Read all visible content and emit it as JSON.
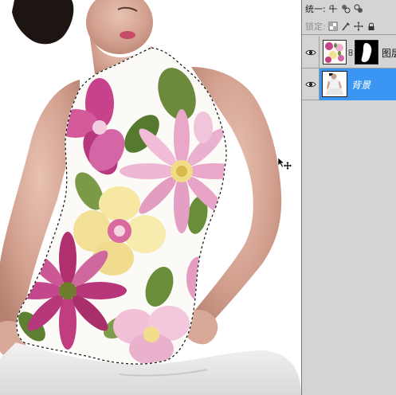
{
  "canvas": {
    "background": "#ffffff",
    "cursor_icon": "move-cursor-icon"
  },
  "layers_panel": {
    "unify_label": "统一:",
    "unify_icons": [
      "unify-position-icon",
      "unify-visibility-icon",
      "unify-style-icon"
    ],
    "lock_label": "锁定:",
    "lock_icons": [
      "lock-transparent-icon",
      "lock-image-icon",
      "lock-position-icon",
      "lock-all-icon"
    ],
    "layers": [
      {
        "name": "图层",
        "visible": true,
        "selected": false,
        "has_mask": true
      },
      {
        "name": "背景",
        "visible": true,
        "selected": true,
        "has_mask": false
      }
    ],
    "colors": {
      "panel_bg": "#d4d4d4",
      "selected_bg": "#3b95f2",
      "selected_text": "#ffffff"
    }
  }
}
